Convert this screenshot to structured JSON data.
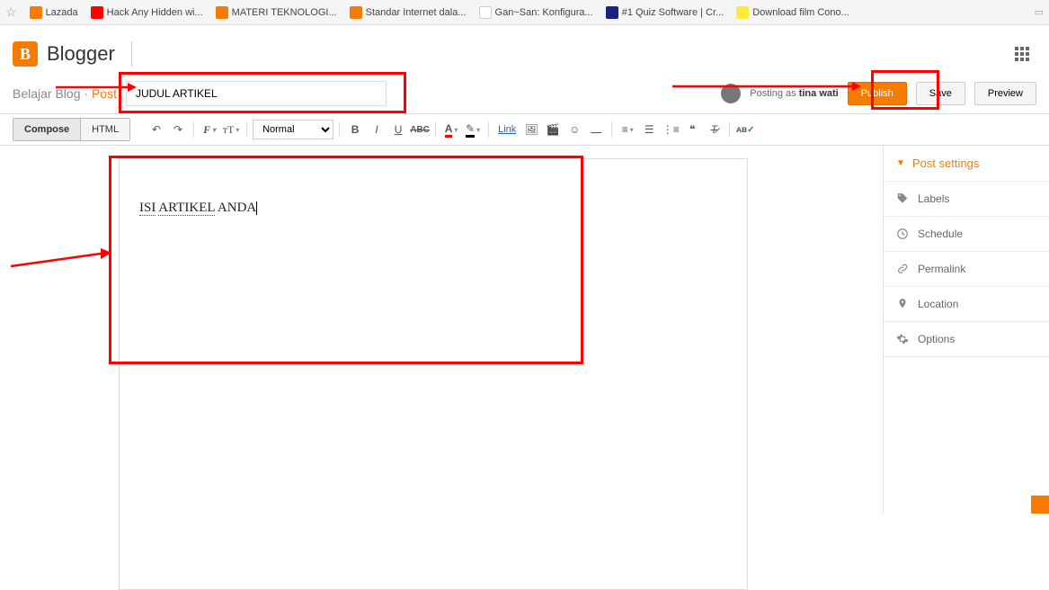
{
  "bookmarks": [
    {
      "label": "Lazada",
      "icon_bg": "#f57c00"
    },
    {
      "label": "Hack Any Hidden wi...",
      "icon_bg": "#ff0000"
    },
    {
      "label": "MATERI TEKNOLOGI...",
      "icon_bg": "#f57c00"
    },
    {
      "label": "Standar Internet dala...",
      "icon_bg": "#f57c00"
    },
    {
      "label": "Gan~San: Konfigura...",
      "icon_bg": "#ffffff"
    },
    {
      "label": "#1 Quiz Software | Cr...",
      "icon_bg": "#1a237e"
    },
    {
      "label": "Download film Cono...",
      "icon_bg": "#ffeb3b"
    }
  ],
  "header": {
    "logo_text": "Blogger"
  },
  "breadcrumb": {
    "site": "Belajar Blog",
    "separator": "›",
    "section": "Post"
  },
  "title_value": "JUDUL ARTIKEL",
  "posting_as_prefix": "Posting as ",
  "posting_as_user": "tina wati",
  "buttons": {
    "publish": "Publish",
    "save": "Save",
    "preview": "Preview"
  },
  "mode_tabs": {
    "compose": "Compose",
    "html": "HTML"
  },
  "format_value": "Normal",
  "link_label": "Link",
  "content_text": "ISI ARTIKEL ANDA",
  "sidebar": {
    "header": "Post settings",
    "items": [
      {
        "label": "Labels"
      },
      {
        "label": "Schedule"
      },
      {
        "label": "Permalink"
      },
      {
        "label": "Location"
      },
      {
        "label": "Options"
      }
    ]
  }
}
